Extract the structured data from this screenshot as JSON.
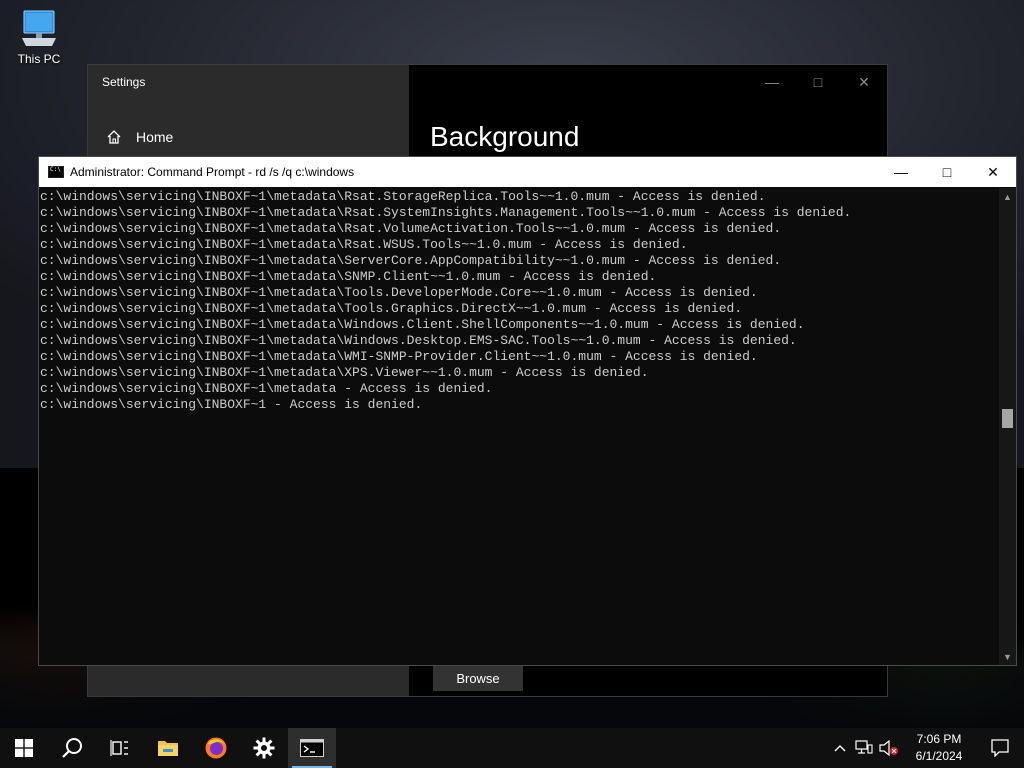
{
  "desktop": {
    "icons": [
      {
        "label": "This PC",
        "icon": "computer-icon"
      }
    ]
  },
  "settings_window": {
    "title": "Settings",
    "nav_home": "Home",
    "page_title": "Background",
    "browse_label": "Browse"
  },
  "cmd_window": {
    "title": "Administrator: Command Prompt - rd  /s /q c:\\windows",
    "lines": [
      "c:\\windows\\servicing\\INBOXF~1\\metadata\\Rsat.StorageReplica.Tools~~1.0.mum - Access is denied.",
      "c:\\windows\\servicing\\INBOXF~1\\metadata\\Rsat.SystemInsights.Management.Tools~~1.0.mum - Access is denied.",
      "c:\\windows\\servicing\\INBOXF~1\\metadata\\Rsat.VolumeActivation.Tools~~1.0.mum - Access is denied.",
      "c:\\windows\\servicing\\INBOXF~1\\metadata\\Rsat.WSUS.Tools~~1.0.mum - Access is denied.",
      "c:\\windows\\servicing\\INBOXF~1\\metadata\\ServerCore.AppCompatibility~~1.0.mum - Access is denied.",
      "c:\\windows\\servicing\\INBOXF~1\\metadata\\SNMP.Client~~1.0.mum - Access is denied.",
      "c:\\windows\\servicing\\INBOXF~1\\metadata\\Tools.DeveloperMode.Core~~1.0.mum - Access is denied.",
      "c:\\windows\\servicing\\INBOXF~1\\metadata\\Tools.Graphics.DirectX~~1.0.mum - Access is denied.",
      "c:\\windows\\servicing\\INBOXF~1\\metadata\\Windows.Client.ShellComponents~~1.0.mum - Access is denied.",
      "c:\\windows\\servicing\\INBOXF~1\\metadata\\Windows.Desktop.EMS-SAC.Tools~~1.0.mum - Access is denied.",
      "c:\\windows\\servicing\\INBOXF~1\\metadata\\WMI-SNMP-Provider.Client~~1.0.mum - Access is denied.",
      "c:\\windows\\servicing\\INBOXF~1\\metadata\\XPS.Viewer~~1.0.mum - Access is denied.",
      "c:\\windows\\servicing\\INBOXF~1\\metadata - Access is denied.",
      "c:\\windows\\servicing\\INBOXF~1 - Access is denied."
    ],
    "scroll_position": 0.48
  },
  "taskbar": {
    "items": [
      {
        "name": "start",
        "icon": "windows-logo-icon"
      },
      {
        "name": "search",
        "icon": "search-icon"
      },
      {
        "name": "task-view",
        "icon": "task-view-icon"
      },
      {
        "name": "file-explorer",
        "icon": "folder-icon"
      },
      {
        "name": "firefox",
        "icon": "firefox-icon"
      },
      {
        "name": "settings",
        "icon": "gear-icon"
      },
      {
        "name": "command-prompt",
        "icon": "terminal-icon",
        "active": true
      }
    ],
    "tray": {
      "time": "7:06 PM",
      "date": "6/1/2024"
    }
  },
  "colors": {
    "accent": "#76b9ed",
    "console_text": "#cccccc",
    "console_bg": "#0c0c0c"
  }
}
